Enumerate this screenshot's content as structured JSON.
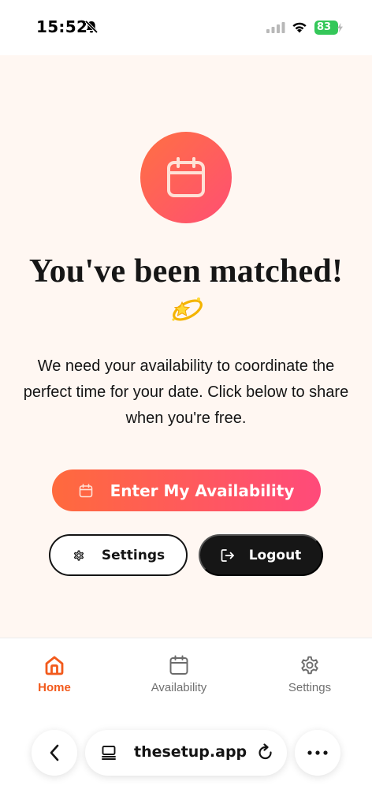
{
  "status_bar": {
    "time": "15:52",
    "battery": "83",
    "icons": [
      "bell-slash-icon",
      "signal-icon",
      "wifi-icon",
      "battery-icon"
    ]
  },
  "hero": {
    "icon": "calendar-icon",
    "title": "You've been matched!",
    "emoji": "dizzy-star-emoji",
    "description": "We need your availability to coordinate the perfect time for your date. Click below to share when you're free."
  },
  "actions": {
    "primary_label": "Enter My Availability",
    "settings_label": "Settings",
    "logout_label": "Logout"
  },
  "tabbar": {
    "tabs": [
      {
        "label": "Home",
        "icon": "home-icon",
        "active": true
      },
      {
        "label": "Availability",
        "icon": "calendar-icon",
        "active": false
      },
      {
        "label": "Settings",
        "icon": "gear-icon",
        "active": false
      }
    ]
  },
  "browser": {
    "url": "thesetup.app"
  },
  "colors": {
    "accent": "#f25a1c",
    "gradient_start": "#ff6a3d",
    "gradient_end": "#ff4a7a",
    "background": "#fff7f2",
    "dark": "#161616"
  }
}
